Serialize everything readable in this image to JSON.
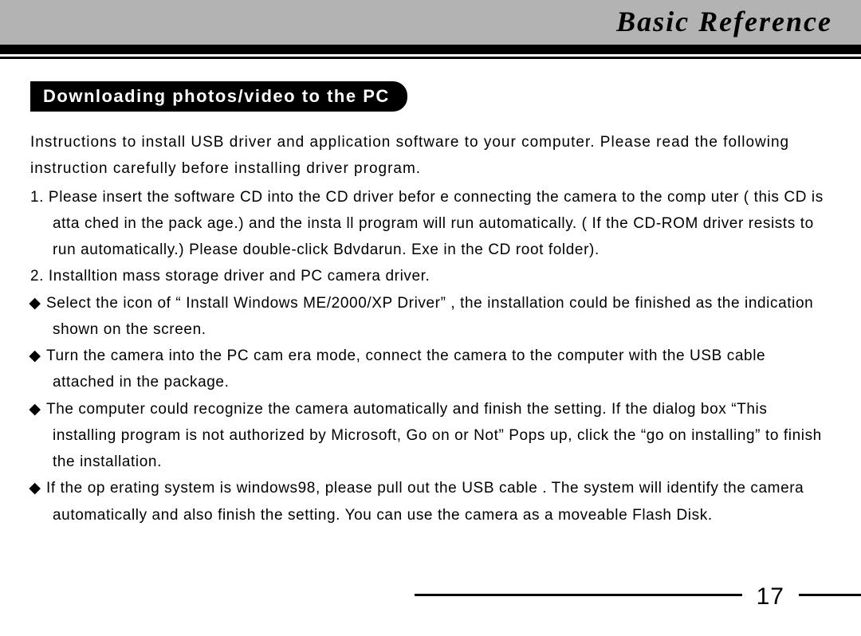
{
  "header": {
    "title": "Basic Reference"
  },
  "section": {
    "title": "Downloading photos/video to the PC"
  },
  "intro": "Instructions to install USB driver and application software to your computer. Please read the following instruction carefully before installing driver program.",
  "items": {
    "i1": "1. Please insert the software CD into the CD driver befor e connecting the camera to the comp uter ( this CD is atta ched in the pack age.) and the insta ll program will run automatically. ( If the CD-ROM driver resists to run automatically.) Please double-click Bdvdarun. Exe in the CD root folder).",
    "i2": "2. Installtion mass storage driver and PC camera driver.",
    "b1": "Select the icon of “ Install Windows ME/2000/XP Driver” , the installation could be finished as the indication shown on the screen.",
    "b2": "Turn the camera into the PC cam era mode, connect the camera to the computer with the USB cable attached in the package.",
    "b3": "The computer could recognize the camera automatically and finish the setting. If the dialog box “This installing program is not authorized by Microsoft, Go on or Not” Pops up, click the  “go on installing” to finish the installation.",
    "b4": "If the op erating system is windows98, please pull out the USB cable . The system will identify the camera automatically and also finish the setting. You can use the camera as a moveable Flash Disk."
  },
  "page_number": "17"
}
